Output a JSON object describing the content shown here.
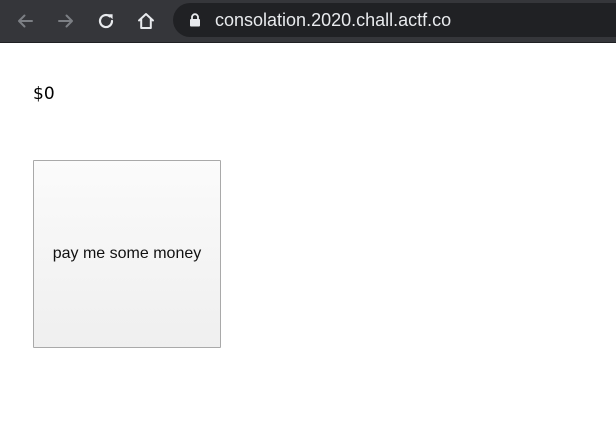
{
  "browser": {
    "url": "consolation.2020.chall.actf.co",
    "icons": {
      "back": "arrow-left-icon",
      "forward": "arrow-right-icon",
      "reload": "reload-icon",
      "home": "home-icon",
      "lock": "lock-icon"
    }
  },
  "page": {
    "amount": "$0",
    "pay_button_label": "pay me some money"
  }
}
